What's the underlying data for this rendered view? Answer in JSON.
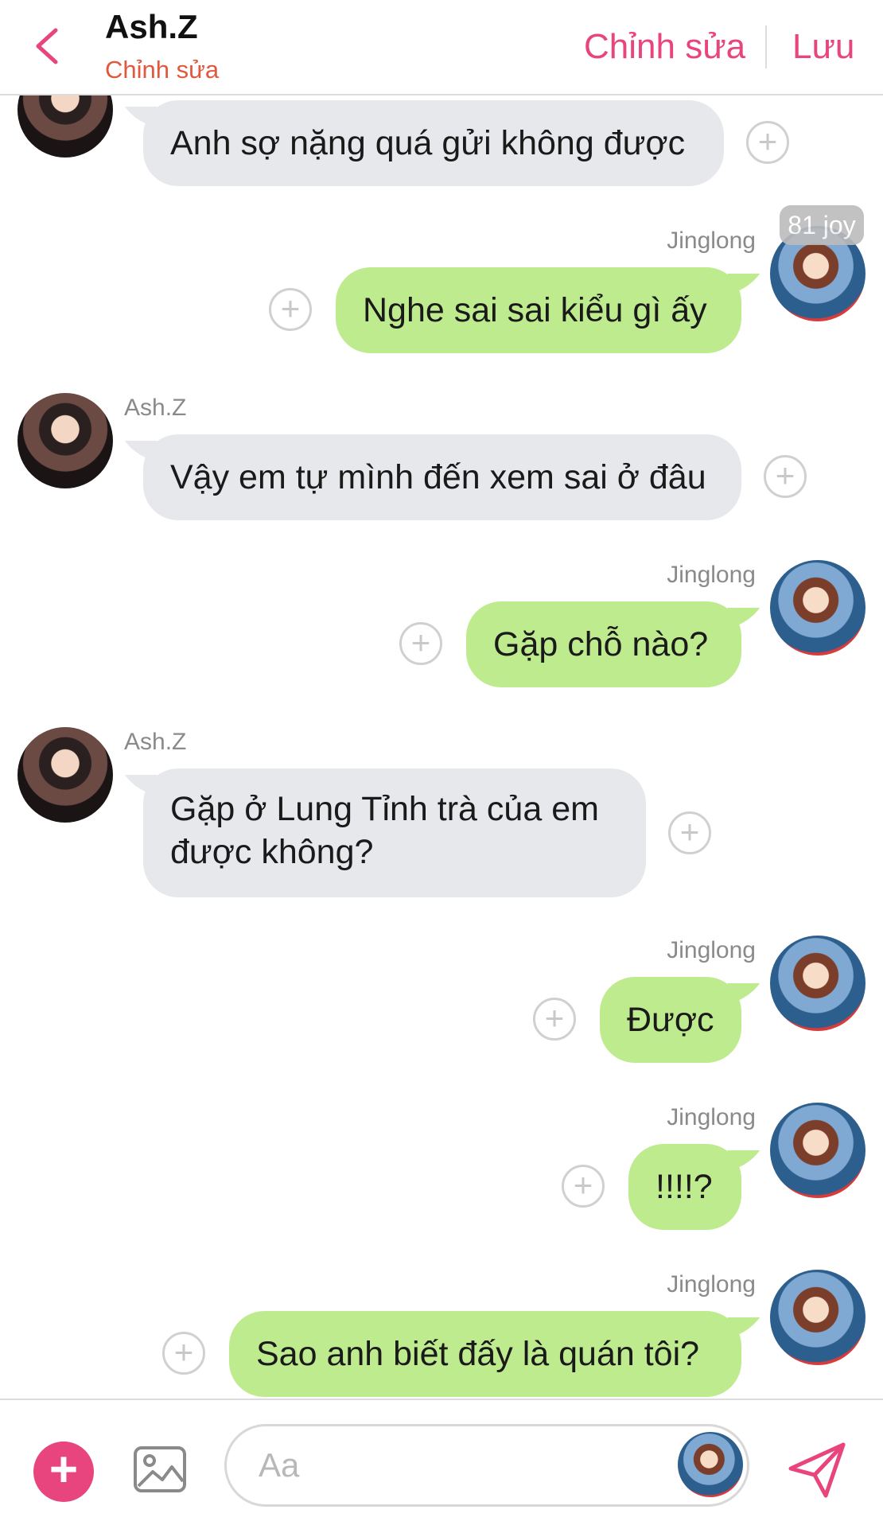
{
  "header": {
    "contact_name": "Ash.Z",
    "contact_subtitle": "Chỉnh sửa",
    "edit_label": "Chỉnh sửa",
    "save_label": "Lưu"
  },
  "reaction_badge": "81 joy",
  "messages": [
    {
      "from": "Ash.Z",
      "sender_label": "",
      "text": "Anh sợ nặng quá gửi không được"
    },
    {
      "from": "Jinglong",
      "sender_label": "Jinglong",
      "text": "Nghe sai sai kiểu gì ấy"
    },
    {
      "from": "Ash.Z",
      "sender_label": "Ash.Z",
      "text": "Vậy em tự mình đến xem sai ở đâu"
    },
    {
      "from": "Jinglong",
      "sender_label": "Jinglong",
      "text": "Gặp chỗ nào?"
    },
    {
      "from": "Ash.Z",
      "sender_label": "Ash.Z",
      "text": "Gặp ở Lung Tỉnh trà của em được không?"
    },
    {
      "from": "Jinglong",
      "sender_label": "Jinglong",
      "text": "Được"
    },
    {
      "from": "Jinglong",
      "sender_label": "Jinglong",
      "text": "!!!!?"
    },
    {
      "from": "Jinglong",
      "sender_label": "Jinglong",
      "text": "Sao anh biết đấy là quán tôi?"
    }
  ],
  "composer": {
    "placeholder": "Aa"
  },
  "colors": {
    "accent": "#e8457f",
    "subtitle": "#e0593e",
    "incoming_bubble": "#e6e8eb",
    "outgoing_bubble": "#bfeb8f"
  },
  "icons": [
    "back-chevron-icon",
    "add-icon",
    "image-icon",
    "send-icon",
    "reaction-add-icon"
  ]
}
